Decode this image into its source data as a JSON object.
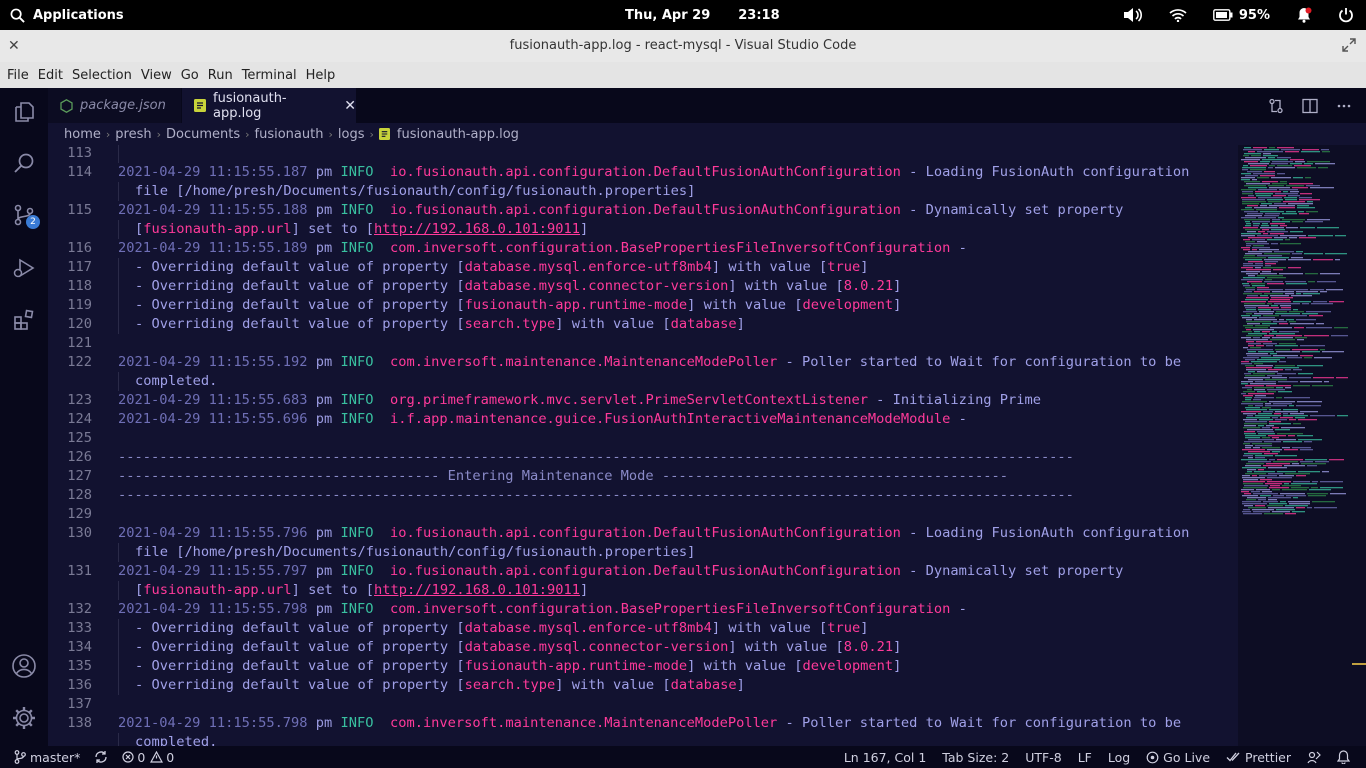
{
  "topbar": {
    "applications_label": "Applications",
    "date": "Thu, Apr 29",
    "time": "23:18",
    "battery": "95%"
  },
  "window": {
    "title": "fusionauth-app.log - react-mysql - Visual Studio Code"
  },
  "menu": [
    "File",
    "Edit",
    "Selection",
    "View",
    "Go",
    "Run",
    "Terminal",
    "Help"
  ],
  "tabs": [
    {
      "label": "package.json",
      "active": false
    },
    {
      "label": "fusionauth-app.log",
      "active": true
    }
  ],
  "breadcrumb": [
    "home",
    "presh",
    "Documents",
    "fusionauth",
    "logs",
    "fusionauth-app.log"
  ],
  "activity": {
    "scm_badge": "2"
  },
  "editor": {
    "lines": [
      {
        "n": "113",
        "kind": "empty"
      },
      {
        "n": "114",
        "kind": "log",
        "ts": "2021-04-29 11:15:55.187",
        "pm": "pm",
        "lvl": "INFO",
        "cls": "io.fusionauth.api.configuration.DefaultFusionAuthConfiguration",
        "msg": " - Loading FusionAuth configuration"
      },
      {
        "n": "",
        "kind": "cont",
        "text": "file [/home/presh/Documents/fusionauth/config/fusionauth.properties]"
      },
      {
        "n": "115",
        "kind": "log",
        "ts": "2021-04-29 11:15:55.188",
        "pm": "pm",
        "lvl": "INFO",
        "cls": "io.fusionauth.api.configuration.DefaultFusionAuthConfiguration",
        "msg": " - Dynamically set property"
      },
      {
        "n": "",
        "kind": "contprop",
        "a": "[",
        "p": "fusionauth-app.url",
        "b": "] set to [",
        "u": "http://192.168.0.101:9011",
        "c": "]"
      },
      {
        "n": "116",
        "kind": "log",
        "ts": "2021-04-29 11:15:55.189",
        "pm": "pm",
        "lvl": "INFO",
        "cls": "com.inversoft.configuration.BasePropertiesFileInversoftConfiguration",
        "msg": " -"
      },
      {
        "n": "117",
        "kind": "override",
        "pre": "- Overriding default value of property [",
        "prop": "database.mysql.enforce-utf8mb4",
        "mid": "] with value [",
        "val": "true",
        "post": "]"
      },
      {
        "n": "118",
        "kind": "override",
        "pre": "- Overriding default value of property [",
        "prop": "database.mysql.connector-version",
        "mid": "] with value [",
        "val": "8.0.21",
        "post": "]"
      },
      {
        "n": "119",
        "kind": "override",
        "pre": "- Overriding default value of property [",
        "prop": "fusionauth-app.runtime-mode",
        "mid": "] with value [",
        "val": "development",
        "post": "]"
      },
      {
        "n": "120",
        "kind": "override",
        "pre": "- Overriding default value of property [",
        "prop": "search.type",
        "mid": "] with value [",
        "val": "database",
        "post": "]"
      },
      {
        "n": "121",
        "kind": "empty"
      },
      {
        "n": "122",
        "kind": "log",
        "ts": "2021-04-29 11:15:55.192",
        "pm": "pm",
        "lvl": "INFO",
        "cls": "com.inversoft.maintenance.MaintenanceModePoller",
        "msg": " - Poller started to Wait for configuration to be"
      },
      {
        "n": "",
        "kind": "cont",
        "text": "completed."
      },
      {
        "n": "123",
        "kind": "log",
        "ts": "2021-04-29 11:15:55.683",
        "pm": "pm",
        "lvl": "INFO",
        "cls": "org.primeframework.mvc.servlet.PrimeServletContextListener",
        "msg": " - Initializing Prime"
      },
      {
        "n": "124",
        "kind": "log",
        "ts": "2021-04-29 11:15:55.696",
        "pm": "pm",
        "lvl": "INFO",
        "cls": "i.f.app.maintenance.guice.FusionAuthInteractiveMaintenanceModeModule",
        "msg": " -"
      },
      {
        "n": "125",
        "kind": "empty"
      },
      {
        "n": "126",
        "kind": "dash",
        "text": "--------------------------------------------------------------------------------------------------------------------"
      },
      {
        "n": "127",
        "kind": "dash",
        "text": "--------------------------------------- Entering Maintenance Mode ------------------------------------------"
      },
      {
        "n": "128",
        "kind": "dash",
        "text": "--------------------------------------------------------------------------------------------------------------------"
      },
      {
        "n": "129",
        "kind": "empty"
      },
      {
        "n": "130",
        "kind": "log",
        "ts": "2021-04-29 11:15:55.796",
        "pm": "pm",
        "lvl": "INFO",
        "cls": "io.fusionauth.api.configuration.DefaultFusionAuthConfiguration",
        "msg": " - Loading FusionAuth configuration"
      },
      {
        "n": "",
        "kind": "cont",
        "text": "file [/home/presh/Documents/fusionauth/config/fusionauth.properties]"
      },
      {
        "n": "131",
        "kind": "log",
        "ts": "2021-04-29 11:15:55.797",
        "pm": "pm",
        "lvl": "INFO",
        "cls": "io.fusionauth.api.configuration.DefaultFusionAuthConfiguration",
        "msg": " - Dynamically set property"
      },
      {
        "n": "",
        "kind": "contprop",
        "a": "[",
        "p": "fusionauth-app.url",
        "b": "] set to [",
        "u": "http://192.168.0.101:9011",
        "c": "]"
      },
      {
        "n": "132",
        "kind": "log",
        "ts": "2021-04-29 11:15:55.798",
        "pm": "pm",
        "lvl": "INFO",
        "cls": "com.inversoft.configuration.BasePropertiesFileInversoftConfiguration",
        "msg": " -"
      },
      {
        "n": "133",
        "kind": "override",
        "pre": "- Overriding default value of property [",
        "prop": "database.mysql.enforce-utf8mb4",
        "mid": "] with value [",
        "val": "true",
        "post": "]"
      },
      {
        "n": "134",
        "kind": "override",
        "pre": "- Overriding default value of property [",
        "prop": "database.mysql.connector-version",
        "mid": "] with value [",
        "val": "8.0.21",
        "post": "]"
      },
      {
        "n": "135",
        "kind": "override",
        "pre": "- Overriding default value of property [",
        "prop": "fusionauth-app.runtime-mode",
        "mid": "] with value [",
        "val": "development",
        "post": "]"
      },
      {
        "n": "136",
        "kind": "override",
        "pre": "- Overriding default value of property [",
        "prop": "search.type",
        "mid": "] with value [",
        "val": "database",
        "post": "]"
      },
      {
        "n": "137",
        "kind": "empty"
      },
      {
        "n": "138",
        "kind": "log",
        "ts": "2021-04-29 11:15:55.798",
        "pm": "pm",
        "lvl": "INFO",
        "cls": "com.inversoft.maintenance.MaintenanceModePoller",
        "msg": " - Poller started to Wait for configuration to be"
      },
      {
        "n": "",
        "kind": "cont",
        "text": "completed."
      }
    ]
  },
  "statusbar": {
    "branch": "master*",
    "errors": "0",
    "warnings": "0",
    "position": "Ln 167, Col 1",
    "tab_size": "Tab Size: 2",
    "encoding": "UTF-8",
    "eol": "LF",
    "language": "Log",
    "go_live": "Go Live",
    "prettier": "Prettier"
  },
  "colors": {
    "editor_bg": "#121230",
    "class_pink": "#ff3a9a",
    "info_teal": "#39c0a0",
    "text_lavender": "#a0a0e8"
  }
}
